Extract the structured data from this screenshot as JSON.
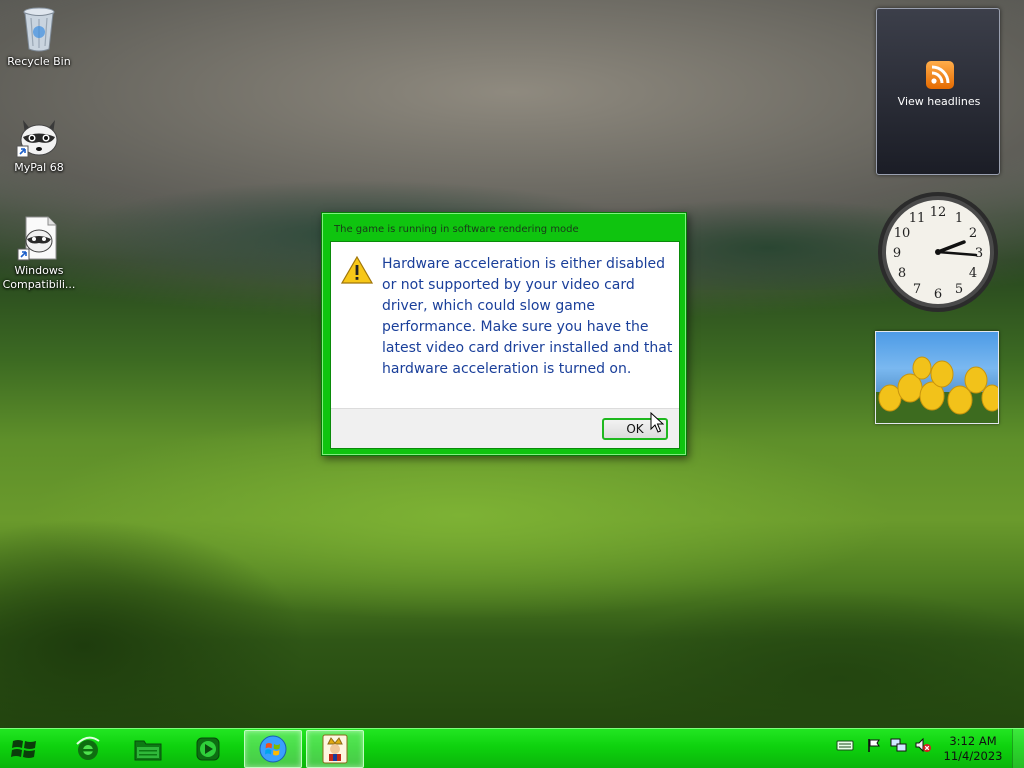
{
  "desktop": {
    "icons": [
      {
        "label": "Recycle Bin",
        "icon": "recycle-bin-icon"
      },
      {
        "label": "MyPal 68",
        "icon": "raccoon-app-icon"
      },
      {
        "label": "Windows Compatibili...",
        "icon": "compatibility-document-icon"
      }
    ]
  },
  "gadgets": {
    "feed_label": "View headlines",
    "clock_numerals": [
      "12",
      "1",
      "2",
      "3",
      "4",
      "5",
      "6",
      "7",
      "8",
      "9",
      "10",
      "11"
    ]
  },
  "dialog": {
    "title": "The game is running in software rendering mode",
    "message": "Hardware acceleration is either disabled or not supported by your video card driver, which could slow game performance. Make sure you have the latest video card driver installed and that hardware acceleration is turned on.",
    "ok_label": "OK",
    "warning_icon": "warning-icon"
  },
  "taskbar": {
    "time": "3:12 AM",
    "date": "11/4/2023",
    "pinned": [
      "start-orb-icon",
      "internet-explorer-icon",
      "file-explorer-icon",
      "media-player-icon",
      "windows-logo-icon",
      "solitaire-icon"
    ]
  },
  "colors": {
    "dialog_frame": "#0fc40f",
    "taskbar": "#0ed20e",
    "message_text": "#1a3f9a"
  }
}
